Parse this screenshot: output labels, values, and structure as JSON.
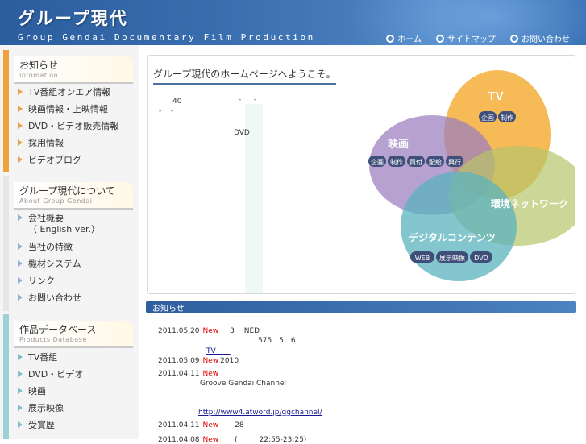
{
  "header": {
    "title": "グループ現代",
    "subtitle": "Group Gendai  Documentary Film Production",
    "nav": [
      "ホーム",
      "サイトマップ",
      "お問い合わせ"
    ]
  },
  "sidebar": {
    "sections": [
      {
        "title": "お知らせ",
        "subtitle": "Infomation",
        "color": "#f0a33a",
        "items": [
          "TV番組オンエア情報",
          "映画情報・上映情報",
          "DVD・ビデオ販売情報",
          "採用情報",
          "ビデオブログ"
        ]
      },
      {
        "title": "グループ現代について",
        "subtitle": "About Group Gendai",
        "color": "#e6e6e6",
        "items": [
          "会社概要",
          "当社の特徴",
          "機材システム",
          "リンク",
          "お問い合わせ"
        ],
        "item0_sub": "（ English ver.）"
      },
      {
        "title": "作品データベース",
        "subtitle": "Products Database",
        "color": "#9dd0d8",
        "items": [
          "TV番組",
          "DVD・ビデオ",
          "映画",
          "展示映像",
          "受賞歴"
        ]
      }
    ]
  },
  "welcome": {
    "title": "グループ現代のホームページへようこそ。",
    "fragments": [
      "40",
      "-",
      "-",
      "-",
      "-",
      "DVD"
    ]
  },
  "venn": {
    "tv": {
      "label": "TV",
      "tags": [
        "企画",
        "制作"
      ],
      "color": "#f3a626"
    },
    "film": {
      "label": "映画",
      "tags": [
        "企画",
        "制作",
        "買付",
        "配給",
        "興行"
      ],
      "color": "#9a7dbf"
    },
    "env": {
      "label": "環境ネットワーク",
      "color": "#b7c46a"
    },
    "digital": {
      "label": "デジタルコンテンツ",
      "tags": [
        "WEB",
        "展示映像",
        "DVD"
      ],
      "color": "#5bb3bd"
    }
  },
  "news": {
    "title": "お知らせ",
    "new_label": "New",
    "rows": [
      {
        "date": "2011.05.20",
        "text": "3　 NED",
        "line2": "575　5　6",
        "link": "TV　　"
      },
      {
        "date": "2011.05.09",
        "text": "2010"
      },
      {
        "date": "2011.04.11",
        "text": "",
        "line2": "Groove Gendai Channel",
        "link": "http://www4.atword.jp/ggchannel/"
      },
      {
        "date": "2011.04.11",
        "text": "28"
      },
      {
        "date": "2011.04.08",
        "text": "(　　　22:55-23:25)"
      }
    ]
  }
}
